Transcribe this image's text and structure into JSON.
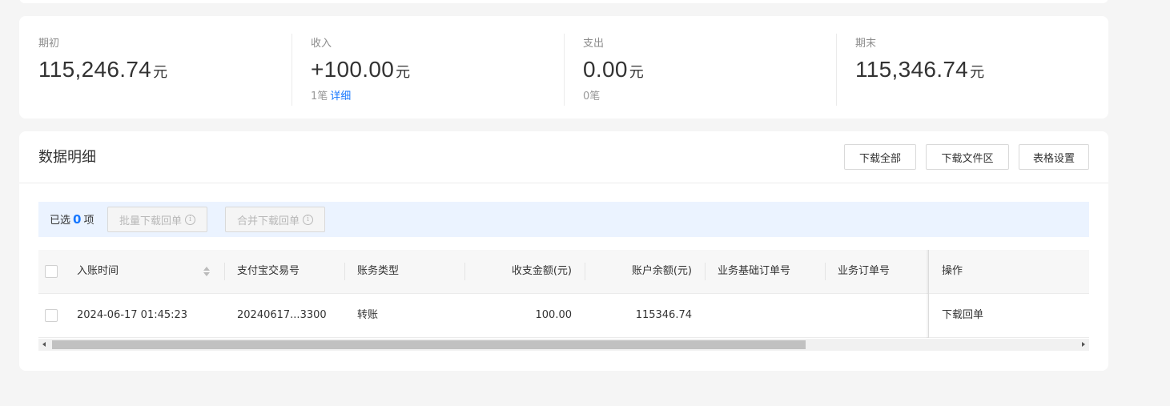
{
  "summary": {
    "opening": {
      "label": "期初",
      "amount": "115,246.74",
      "unit": "元"
    },
    "income": {
      "label": "收入",
      "amount": "+100.00",
      "unit": "元",
      "count": "1笔",
      "detail_link": "详细"
    },
    "expense": {
      "label": "支出",
      "amount": "0.00",
      "unit": "元",
      "count": "0笔"
    },
    "closing": {
      "label": "期末",
      "amount": "115,346.74",
      "unit": "元"
    }
  },
  "detail": {
    "title": "数据明细",
    "buttons": {
      "download_all": "下载全部",
      "download_area": "下载文件区",
      "table_settings": "表格设置"
    },
    "selection": {
      "prefix": "已选",
      "count": "0",
      "suffix": "项",
      "batch_download": "批量下载回单",
      "merge_download": "合并下载回单",
      "info_glyph": "i"
    },
    "table": {
      "columns": [
        "入账时间",
        "支付宝交易号",
        "账务类型",
        "收支金额(元)",
        "账户余额(元)",
        "业务基础订单号",
        "业务订单号",
        "操作"
      ],
      "rows": [
        {
          "time": "2024-06-17 01:45:23",
          "trade_no": "20240617...3300",
          "type": "转账",
          "amount": "100.00",
          "balance": "115346.74",
          "base_order": "",
          "order": "",
          "action": "下载回单"
        }
      ]
    },
    "scroll_position_fraction": 0.0
  },
  "icons": {
    "sort": "sort-icon",
    "info": "info-icon",
    "scroll_left": "arrow-left-icon",
    "scroll_right": "arrow-right-icon"
  },
  "colors": {
    "accent": "#1677ff",
    "selection_bar": "#ebf3ff",
    "background": "#f5f5f5"
  }
}
